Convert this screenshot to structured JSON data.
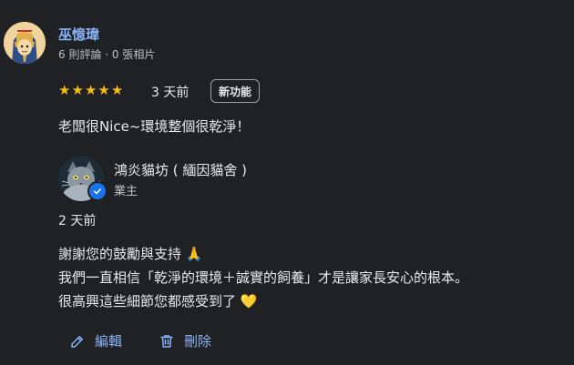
{
  "reviewer": {
    "name": "巫憶瑋",
    "meta": "6 則評論 · 0 張相片",
    "rating": 5,
    "posted": "3 天前",
    "badge": "新功能",
    "text": "老闆很Nice~環境整個很乾淨！"
  },
  "owner_reply": {
    "name": "鴻炎貓坊 ( 緬因貓舍 )",
    "role": "業主",
    "posted": "2 天前",
    "lines": [
      "謝謝您的鼓勵與支持 🙏",
      "我們一直相信「乾淨的環境＋誠實的飼養」才是讓家長安心的根本。",
      "很高興這些細節您都感受到了 💛"
    ]
  },
  "actions": {
    "edit": "編輯",
    "delete": "刪除"
  },
  "colors": {
    "background": "#202124",
    "link": "#8ab4f8",
    "star": "#fbbc04",
    "verified": "#1a73e8"
  }
}
